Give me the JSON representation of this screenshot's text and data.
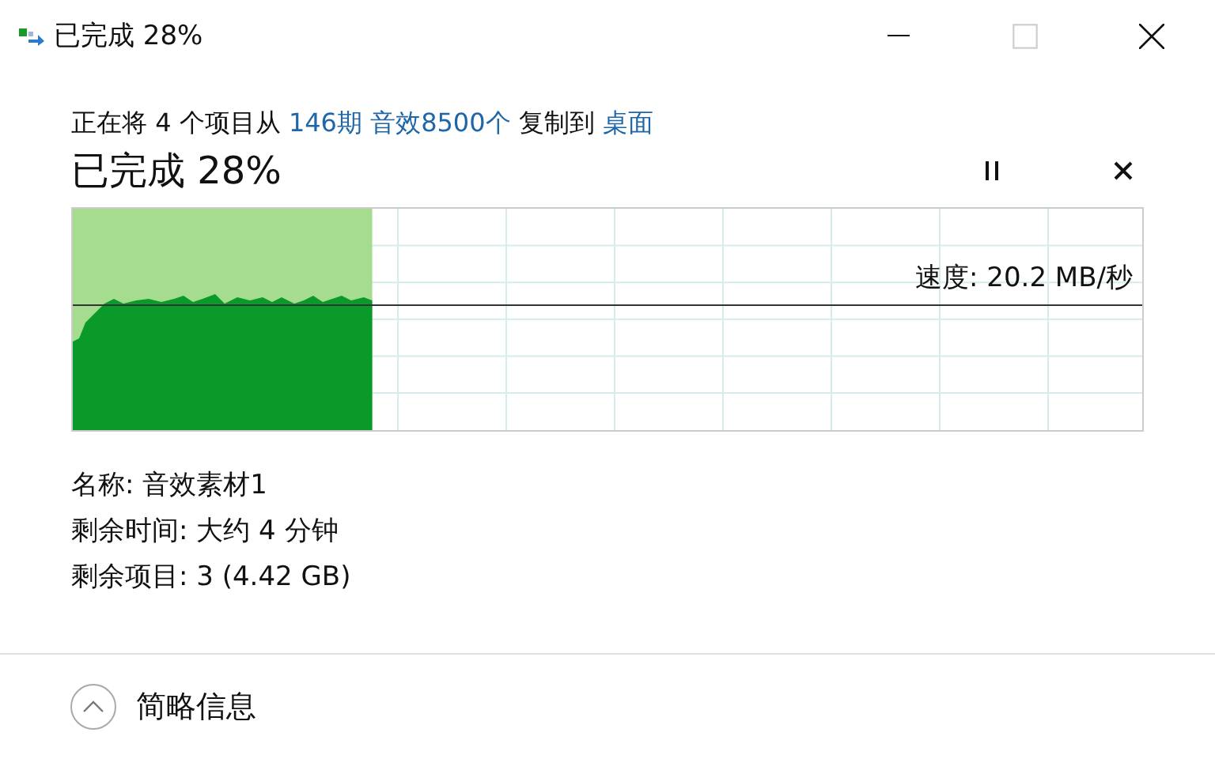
{
  "window": {
    "title": "已完成 28%",
    "maximize_disabled": true
  },
  "copy": {
    "description": [
      {
        "kind": "text",
        "text": "正在将 4 个项目从 "
      },
      {
        "kind": "link",
        "text": "146期 音效8500个"
      },
      {
        "kind": "text",
        "text": " 复制到 "
      },
      {
        "kind": "link",
        "text": "桌面"
      }
    ],
    "status": "已完成 28%",
    "progress": {
      "level": 0.28,
      "speed": "速度: 20.2 MB/秒"
    },
    "details": [
      "名称: 音效素材1",
      "剩余时间: 大约 4 分钟",
      "剩余项目: 3 (4.42 GB)"
    ]
  },
  "footer": {
    "label": "简略信息",
    "expanded": true
  }
}
